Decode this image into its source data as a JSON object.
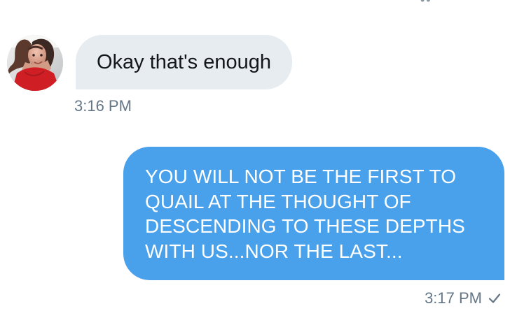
{
  "conversation": {
    "incoming": {
      "message": "Okay that's enough",
      "timestamp": "3:16 PM"
    },
    "outgoing": {
      "lines": [
        "YOU WILL NOT BE THE FIRST TO",
        "QUAIL AT THE THOUGHT OF",
        "DESCENDING TO THESE DEPTHS",
        "WITH US...NOR THE LAST..."
      ],
      "timestamp": "3:17 PM",
      "status_icon": "check-icon"
    }
  },
  "colors": {
    "incoming_bubble": "#e6ecf0",
    "outgoing_bubble": "#4aa1eb",
    "timestamp": "#657786",
    "outgoing_text": "#ffffff"
  }
}
